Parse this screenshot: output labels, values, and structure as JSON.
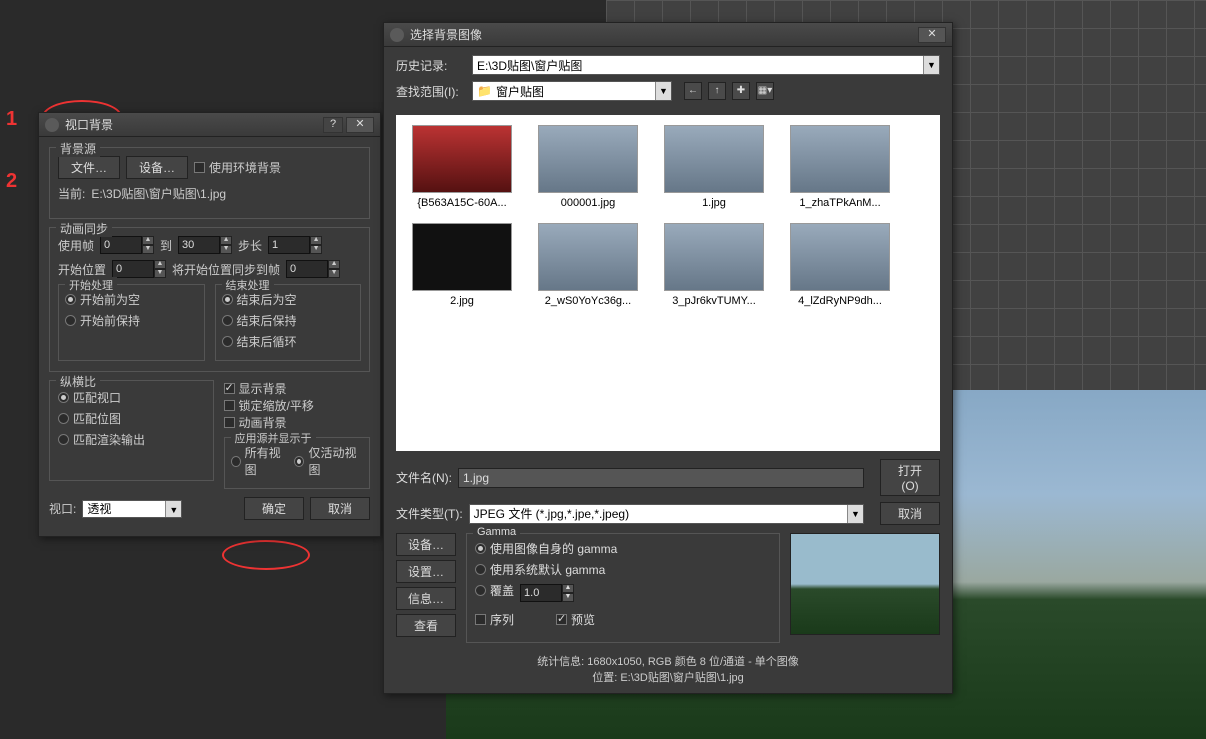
{
  "annotations": {
    "n1": "1",
    "n2": "2"
  },
  "vbg": {
    "title": "视口背景",
    "source": {
      "legend": "背景源",
      "file_btn": "文件…",
      "device_btn": "设备…",
      "use_env": "使用环境背景",
      "current_label": "当前:",
      "current_path": "E:\\3D贴图\\窗户贴图\\1.jpg"
    },
    "anim": {
      "legend": "动画同步",
      "use_frame": "使用帧",
      "use_frame_val": "0",
      "to": "到",
      "to_val": "30",
      "step": "步长",
      "step_val": "1",
      "start_pos": "开始位置",
      "start_pos_val": "0",
      "sync_label": "将开始位置同步到帧",
      "sync_val": "0",
      "start_proc": {
        "legend": "开始处理",
        "blank": "开始前为空",
        "hold": "开始前保持"
      },
      "end_proc": {
        "legend": "结束处理",
        "blank": "结束后为空",
        "hold": "结束后保持",
        "loop": "结束后循环"
      }
    },
    "aspect": {
      "legend": "纵横比",
      "match_vp": "匹配视口",
      "match_bmp": "匹配位图",
      "match_render": "匹配渲染输出"
    },
    "display": {
      "show_bg": "显示背景",
      "lock_zoom": "锁定缩放/平移",
      "anim_bg": "动画背景",
      "apply_legend": "应用源并显示于",
      "all_views": "所有视图",
      "active_only": "仅活动视图"
    },
    "viewport_label": "视口:",
    "viewport_value": "透视",
    "ok": "确定",
    "cancel": "取消"
  },
  "fch": {
    "title": "选择背景图像",
    "history_label": "历史记录:",
    "history_value": "E:\\3D贴图\\窗户贴图",
    "lookin_label": "查找范围(I):",
    "lookin_value": "窗户贴图",
    "files": [
      {
        "name": "{B563A15C-60A...",
        "style": "red"
      },
      {
        "name": "000001.jpg",
        "style": ""
      },
      {
        "name": "1.jpg",
        "style": ""
      },
      {
        "name": "1_zhaTPkAnM...",
        "style": ""
      },
      {
        "name": "2.jpg",
        "style": "dark"
      },
      {
        "name": "2_wS0YoYc36g...",
        "style": ""
      },
      {
        "name": "3_pJr6kvTUMY...",
        "style": ""
      },
      {
        "name": "4_lZdRyNP9dh...",
        "style": ""
      }
    ],
    "filename_label": "文件名(N):",
    "filename_value": "1.jpg",
    "filetype_label": "文件类型(T):",
    "filetype_value": "JPEG 文件 (*.jpg,*.jpe,*.jpeg)",
    "open_btn": "打开(O)",
    "cancel_btn": "取消",
    "side_btns": {
      "device": "设备…",
      "setup": "设置…",
      "info": "信息…",
      "view": "查看"
    },
    "gamma": {
      "legend": "Gamma",
      "own": "使用图像自身的 gamma",
      "sys": "使用系统默认 gamma",
      "override": "覆盖",
      "override_val": "1.0"
    },
    "sequence": "序列",
    "preview": "预览",
    "stats": "统计信息: 1680x1050, RGB 颜色 8 位/通道 - 单个图像",
    "location": "位置: E:\\3D贴图\\窗户贴图\\1.jpg"
  }
}
